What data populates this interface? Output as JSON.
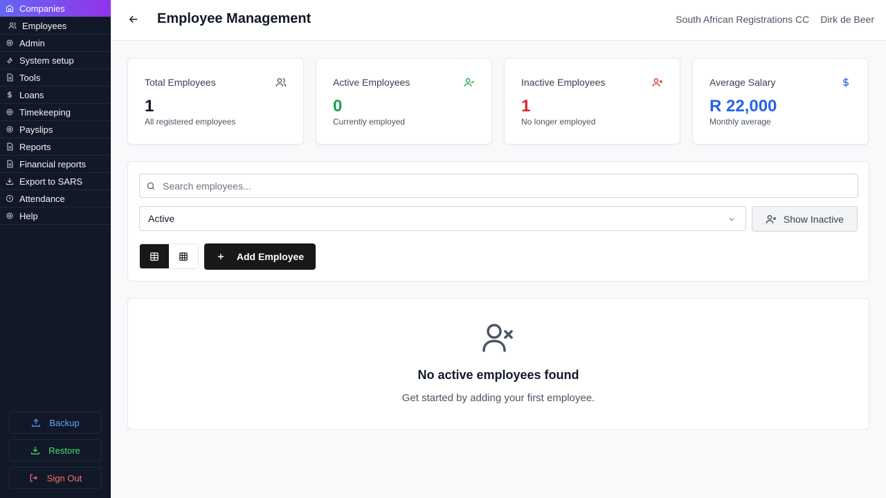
{
  "sidebar": {
    "items": [
      {
        "label": "Companies",
        "icon": "home-icon"
      },
      {
        "label": "Employees",
        "icon": "users-icon"
      },
      {
        "label": "Admin",
        "icon": "gear-icon"
      },
      {
        "label": "System setup",
        "icon": "wrench-icon"
      },
      {
        "label": "Tools",
        "icon": "file-icon"
      },
      {
        "label": "Loans",
        "icon": "dollar-icon"
      },
      {
        "label": "Timekeeping",
        "icon": "gear-icon"
      },
      {
        "label": "Payslips",
        "icon": "gear-icon"
      },
      {
        "label": "Reports",
        "icon": "file-icon"
      },
      {
        "label": "Financial reports",
        "icon": "file-icon"
      },
      {
        "label": "Export to SARS",
        "icon": "download-icon"
      },
      {
        "label": "Attendance",
        "icon": "clock-icon"
      },
      {
        "label": "Help",
        "icon": "gear-icon"
      }
    ],
    "backup_label": "Backup",
    "restore_label": "Restore",
    "signout_label": "Sign Out"
  },
  "header": {
    "title": "Employee Management",
    "company": "South African Registrations CC",
    "user": "Dirk de Beer"
  },
  "stats": [
    {
      "label": "Total Employees",
      "value": "1",
      "sub": "All registered employees",
      "icon": "users-icon",
      "color": "#111827",
      "icon_color": "#4b5563"
    },
    {
      "label": "Active Employees",
      "value": "0",
      "sub": "Currently employed",
      "icon": "user-check-icon",
      "color": "#16a34a",
      "icon_color": "#16a34a"
    },
    {
      "label": "Inactive Employees",
      "value": "1",
      "sub": "No longer employed",
      "icon": "user-x-icon",
      "color": "#dc2626",
      "icon_color": "#dc2626"
    },
    {
      "label": "Average Salary",
      "value": "R 22,000",
      "sub": "Monthly average",
      "icon": "dollar-icon",
      "color": "#2563eb",
      "icon_color": "#2563eb"
    }
  ],
  "filters": {
    "search_placeholder": "Search employees...",
    "status_selected": "Active",
    "show_inactive_label": "Show Inactive",
    "add_employee_label": "Add Employee"
  },
  "empty_state": {
    "title": "No active employees found",
    "description": "Get started by adding your first employee."
  }
}
